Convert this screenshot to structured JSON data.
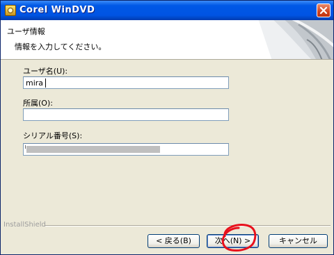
{
  "window": {
    "title": "Corel WinDVD"
  },
  "header": {
    "title": "ユーザ情報",
    "subtitle": "情報を入力してください。"
  },
  "form": {
    "user_name_label": "ユーザ名(U):",
    "user_name_value": "mira",
    "org_label": "所属(O):",
    "org_value": "",
    "serial_label": "シリアル番号(S):",
    "serial_value": "(redacted)"
  },
  "footer": {
    "brand": "InstallShield",
    "back_label": "< 戻る(B)",
    "next_label": "次へ(N) >",
    "cancel_label": "キャンセル"
  },
  "colors": {
    "title_bar": "#0054e3",
    "close_button": "#d2441e",
    "annotation_circle": "#e8101c",
    "dialog_bg": "#ece9d8"
  }
}
